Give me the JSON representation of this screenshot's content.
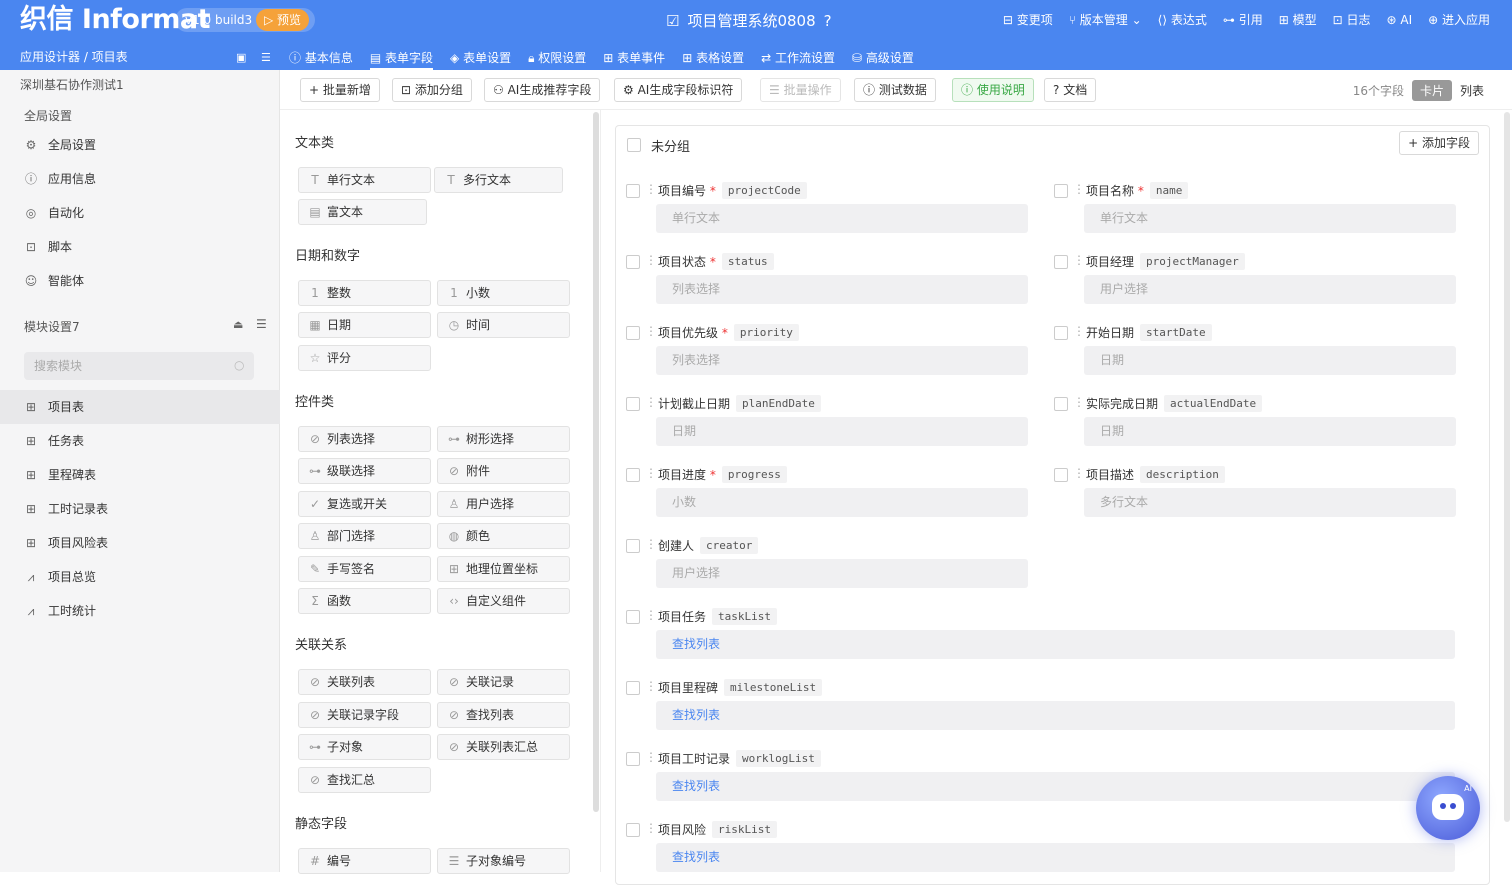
{
  "header": {
    "brand": "织信 Informat",
    "version": "v1.0 build3",
    "preview": "▷ 预览",
    "app_title": "项目管理系统0808",
    "nav": [
      "变更项",
      "版本管理",
      "表达式",
      "引用",
      "模型",
      "日志",
      "AI",
      "进入应用"
    ]
  },
  "breadcrumb": "应用设计器 / 项目表",
  "tabs": [
    "基本信息",
    "表单字段",
    "表单设置",
    "权限设置",
    "表单事件",
    "表格设置",
    "工作流设置",
    "高级设置"
  ],
  "sidebar": {
    "project": "深圳基石协作测试1",
    "global_heading": "全局设置",
    "global_items": [
      "全局设置",
      "应用信息",
      "自动化",
      "脚本",
      "智能体"
    ],
    "module_heading": "模块设置7",
    "search_placeholder": "搜索模块",
    "modules": [
      "项目表",
      "任务表",
      "里程碑表",
      "工时记录表",
      "项目风险表",
      "项目总览",
      "工时统计"
    ]
  },
  "toolbar": {
    "buttons": [
      "+ 批量新增",
      "添加分组",
      "AI生成推荐字段",
      "AI生成字段标识符",
      "批量操作",
      "测试数据",
      "使用说明",
      "文档"
    ],
    "field_count": "16个字段",
    "view_card": "卡片",
    "view_list": "列表"
  },
  "palette": {
    "sections": [
      "文本类",
      "日期和数字",
      "控件类",
      "关联关系",
      "静态字段"
    ],
    "text": [
      "单行文本",
      "多行文本",
      "富文本"
    ],
    "datenum": [
      "整数",
      "小数",
      "日期",
      "时间",
      "评分"
    ],
    "controls": [
      "列表选择",
      "树形选择",
      "级联选择",
      "附件",
      "复选或开关",
      "用户选择",
      "部门选择",
      "颜色",
      "手写签名",
      "地理位置坐标",
      "函数",
      "自定义组件"
    ],
    "relations": [
      "关联列表",
      "关联记录",
      "关联记录字段",
      "查找列表",
      "子对象",
      "关联列表汇总",
      "查找汇总"
    ],
    "static": [
      "编号",
      "子对象编号"
    ]
  },
  "canvas": {
    "group_title": "未分组",
    "add_field": "+ 添加字段",
    "fields": [
      {
        "label": "项目编号",
        "code": "projectCode",
        "type": "单行文本",
        "required": "*"
      },
      {
        "label": "项目名称",
        "code": "name",
        "type": "单行文本",
        "required": "*"
      },
      {
        "label": "项目状态",
        "code": "status",
        "type": "列表选择",
        "required": "*"
      },
      {
        "label": "项目经理",
        "code": "projectManager",
        "type": "用户选择",
        "required": ""
      },
      {
        "label": "项目优先级",
        "code": "priority",
        "type": "列表选择",
        "required": "*"
      },
      {
        "label": "开始日期",
        "code": "startDate",
        "type": "日期",
        "required": ""
      },
      {
        "label": "计划截止日期",
        "code": "planEndDate",
        "type": "日期",
        "required": ""
      },
      {
        "label": "实际完成日期",
        "code": "actualEndDate",
        "type": "日期",
        "required": ""
      },
      {
        "label": "项目进度",
        "code": "progress",
        "type": "小数",
        "required": "*"
      },
      {
        "label": "项目描述",
        "code": "description",
        "type": "多行文本",
        "required": ""
      },
      {
        "label": "创建人",
        "code": "creator",
        "type": "用户选择",
        "required": ""
      },
      {
        "label": "项目任务",
        "code": "taskList",
        "type": "查找列表",
        "required": ""
      },
      {
        "label": "项目里程碑",
        "code": "milestoneList",
        "type": "查找列表",
        "required": ""
      },
      {
        "label": "项目工时记录",
        "code": "worklogList",
        "type": "查找列表",
        "required": ""
      },
      {
        "label": "项目风险",
        "code": "riskList",
        "type": "查找列表",
        "required": ""
      }
    ]
  },
  "assistant_badge": "AI"
}
